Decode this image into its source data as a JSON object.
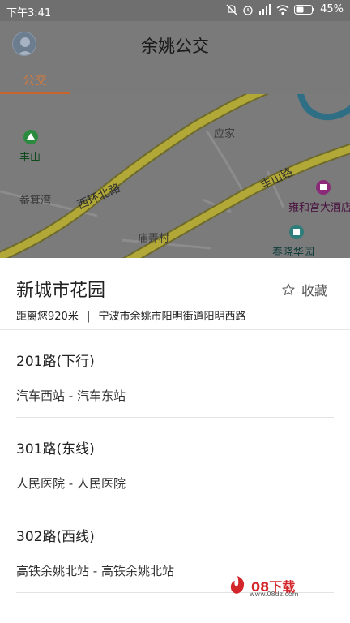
{
  "status_bar": {
    "time": "下午3:41",
    "battery": "45%"
  },
  "header": {
    "title": "余姚公交"
  },
  "tabs": [
    {
      "label": "公交",
      "active": true
    }
  ],
  "map": {
    "labels": {
      "yingjia": "应家",
      "fengshan_poi": "丰山",
      "chanjiwan": "畚箕湾",
      "xihuan_road": "西环北路",
      "fengshan_road": "丰山路",
      "yonghegong": "雍和宫大酒店",
      "miaonongcun": "庙弄村",
      "chunxiao": "春晓华园"
    },
    "colors": {
      "road": "#b1a838",
      "water": "#2f6f86",
      "poi_green": "#2a8a3e",
      "poi_purple": "#8a2a78",
      "poi_teal": "#2d7d7a"
    }
  },
  "stop": {
    "name": "新城市花园",
    "favorite_label": "收藏",
    "distance": "距离您920米",
    "separator": "|",
    "address": "宁波市余姚市阳明街道阳明西路"
  },
  "routes": [
    {
      "name": "201路(下行)",
      "stations": "汽车西站 - 汽车东站"
    },
    {
      "name": "301路(东线)",
      "stations": "人民医院 - 人民医院"
    },
    {
      "name": "302路(西线)",
      "stations": "高铁余姚北站 - 高铁余姚北站"
    }
  ],
  "watermark": {
    "text": "08下载",
    "url": "www.08dz.com"
  }
}
